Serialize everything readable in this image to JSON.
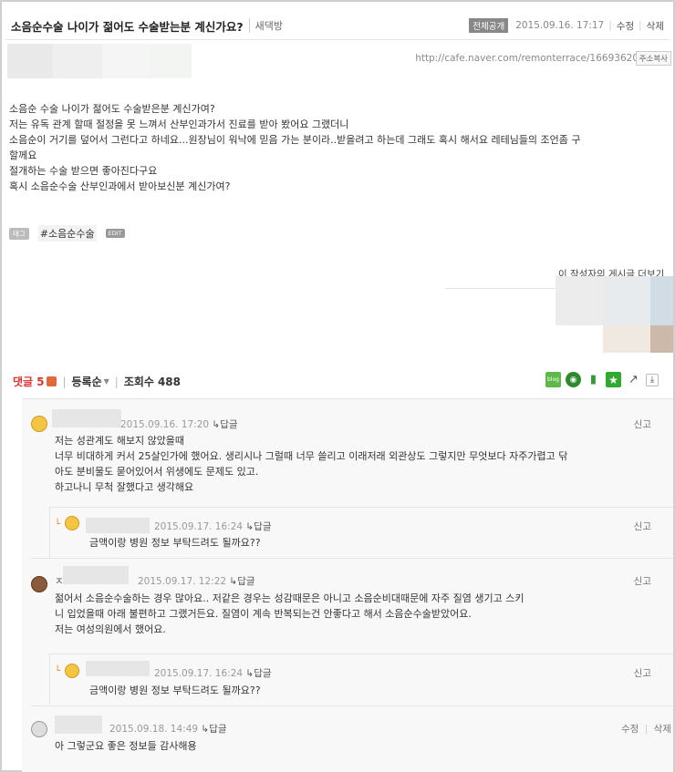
{
  "post": {
    "title": "소음순수술 나이가 젊어도 수술받는분 계신가요?",
    "board": "새댁방",
    "visibility_badge": "전체공개",
    "datetime": "2015.09.16. 17:17",
    "edit_label": "수정",
    "delete_label": "삭제",
    "url": "http://cafe.naver.com/remonterrace/16693620",
    "copy_url_label": "주소복사",
    "body_lines": [
      "소음순 수술 나이가 젊어도 수술받은분 계신가여?",
      "저는 유독 관계 할때 절정을 못 느껴서 산부인과가서 진료를 받아 봤어요 그랬더니",
      "소음순이 거기를 덮어서 그런다고 하네요...원장님이 워낙에 믿음 가는 분이라..받을려고 하는데 그래도 혹시 해서요 레테님들의 조언좀 구",
      "할께요",
      "절개하는 수술 받으면 좋아진다구요",
      "혹시 소음순수술 산부인과에서 받아보신분 계신가여?"
    ],
    "tag_label": "태그",
    "tags": [
      "#소음순수술"
    ],
    "tag_edit_label": "EDIT",
    "more_posts_label": "이 작성자의 게시글 더보기"
  },
  "comment_bar": {
    "label": "댓글",
    "count": "5",
    "sort_label": "등록순",
    "views_label": "조회수",
    "views": "488"
  },
  "share_icons": [
    "blog-icon",
    "me2day-icon",
    "phone-icon",
    "favorite-star-icon",
    "share-icon",
    "download-icon"
  ],
  "comments": {
    "c1": {
      "date": "2015.09.16. 17:20",
      "reply": "답글",
      "report": "신고",
      "lines": [
        "저는 성관계도 해보지 않았을때",
        "너무 비대하게 커서 25살인가에 했어요. 생리시나 그럴때 너무 쓸리고 이래저래 외관상도 그렇지만 무엇보다 자주가렵고 닦",
        "아도 분비물도 묻어있어서 위생에도 문제도 있고.",
        "하고나니 무척 잘했다고 생각해요"
      ]
    },
    "c2": {
      "date": "2015.09.17. 16:24",
      "reply": "답글",
      "report": "신고",
      "lines": [
        "금액이랑 병원 정보 부탁드려도 될까요??"
      ]
    },
    "c3": {
      "nick_visible": "ㅈ",
      "date": "2015.09.17. 12:22",
      "reply": "답글",
      "report": "신고",
      "lines": [
        "젊어서 소음순수술하는 경우 많아요.. 저같은 경우는 성감때문은 아니고 소음순비대때문에 자주 질염 생기고 스키",
        "니 입었을때 아래 불편하고 그랬거든요. 질염이 계속 반복되는건 안좋다고 해서 소음순수술받았어요.",
        "저는 여성의원에서 했어요."
      ]
    },
    "c4": {
      "date": "2015.09.17. 16:24",
      "reply": "답글",
      "report": "신고",
      "lines": [
        "금액이랑 병원 정보 부탁드려도 될까요??"
      ]
    },
    "c5": {
      "date": "2015.09.18. 14:49",
      "reply": "답글",
      "edit": "수정",
      "delete": "삭제",
      "lines": [
        "아 그렇군요 좋은 정보들 감사해용"
      ]
    }
  },
  "colors": {
    "accent_red": "#d33333",
    "badge_gray": "#888888",
    "comment_bg": "#f8f8f8",
    "reply_mark": "#e8821e"
  }
}
